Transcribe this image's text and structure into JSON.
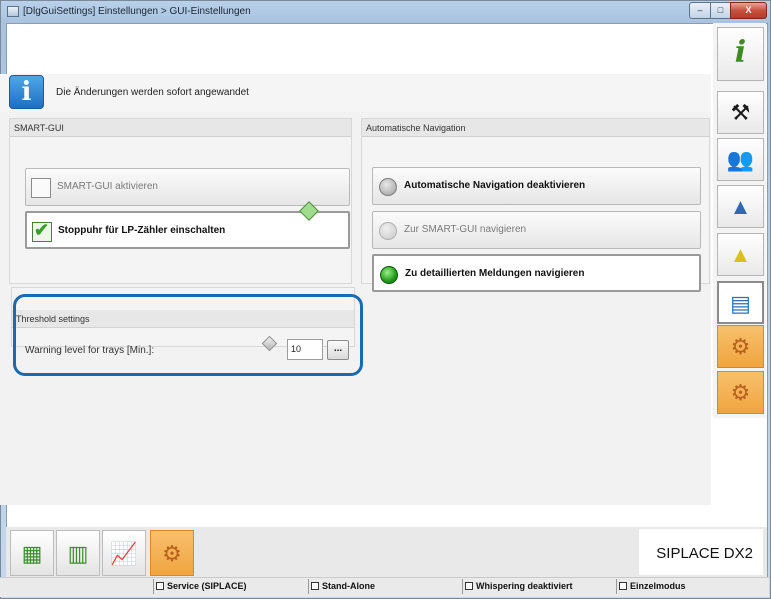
{
  "window": {
    "title": "[DlgGuiSettings] Einstellungen > GUI-Einstellungen",
    "minimize_label": "–",
    "maximize_label": "□",
    "close_label": "X"
  },
  "info_bar": {
    "text": "Die Änderungen werden sofort angewandet"
  },
  "smart_gui": {
    "header": "SMART-GUI",
    "options": [
      {
        "label": "SMART-GUI aktivieren",
        "checked": false
      },
      {
        "label": "Stoppuhr für LP-Zähler einschalten",
        "checked": true
      }
    ]
  },
  "auto_nav": {
    "header": "Automatische Navigation",
    "options": [
      {
        "label": "Automatische Navigation deaktivieren",
        "state": "gray"
      },
      {
        "label": "Zur SMART-GUI navigieren",
        "state": "disabled"
      },
      {
        "label": "Zu detaillierten Meldungen navigieren",
        "state": "green"
      }
    ]
  },
  "threshold": {
    "header": "Threshold settings",
    "label": "Warning level for trays [Min.]:",
    "value": "10",
    "button_label": "..."
  },
  "side_nav": [
    {
      "icon": "info-icon"
    },
    {
      "icon": "line-station-icon"
    },
    {
      "icon": "users-icon"
    },
    {
      "icon": "warning-ma-icon"
    },
    {
      "icon": "warning-sw-icon"
    },
    {
      "icon": "chart-settings-icon"
    },
    {
      "icon": "tool-orange-icon"
    },
    {
      "icon": "feeder-orange-icon"
    }
  ],
  "bottom_nav": [
    {
      "icon": "stacked-money-icon"
    },
    {
      "icon": "grid-table-icon"
    },
    {
      "icon": "line-chart-icon"
    },
    {
      "icon": "tool-orange-icon"
    }
  ],
  "brand": "SIPLACE DX2",
  "status_bar": {
    "items": [
      "Service (SIPLACE)",
      "Stand-Alone",
      "Whispering deaktiviert",
      "Einzelmodus"
    ]
  },
  "colors": {
    "highlight_ring": "#1969b3",
    "accent_orange": "#f0a43f",
    "radio_green": "#1f9a1a"
  }
}
